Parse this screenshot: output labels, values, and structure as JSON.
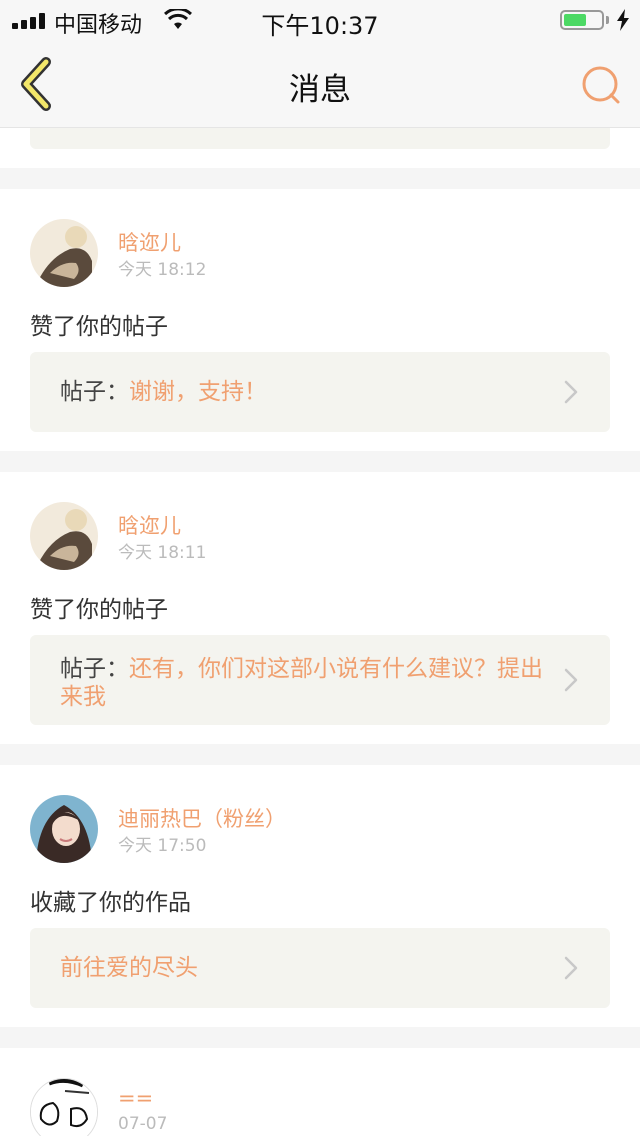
{
  "status_bar": {
    "carrier": "中国移动",
    "time": "下午10:37",
    "battery_level_percent": 60
  },
  "nav": {
    "title": "消息",
    "back_icon": "chevron-left-icon",
    "search_icon": "search-icon"
  },
  "colors": {
    "accent": "#f0a070",
    "card_bg": "#ffffff",
    "post_box_bg": "#f4f4ef",
    "divider_bg": "#f5f5f5"
  },
  "messages": [
    {
      "user": "晗迩儿",
      "time": "今天 18:12",
      "action": "赞了你的帖子",
      "post_prefix": "帖子：",
      "post_text": "谢谢，支持！"
    },
    {
      "user": "晗迩儿",
      "time": "今天 18:11",
      "action": "赞了你的帖子",
      "post_prefix": "帖子：",
      "post_text": "还有，你们对这部小说有什么建议？提出来我"
    },
    {
      "user": "迪丽热巴（粉丝）",
      "time": "今天 17:50",
      "action": "收藏了你的作品",
      "post_text": "前往爱的尽头"
    },
    {
      "user": "==",
      "time": "07-07"
    }
  ]
}
